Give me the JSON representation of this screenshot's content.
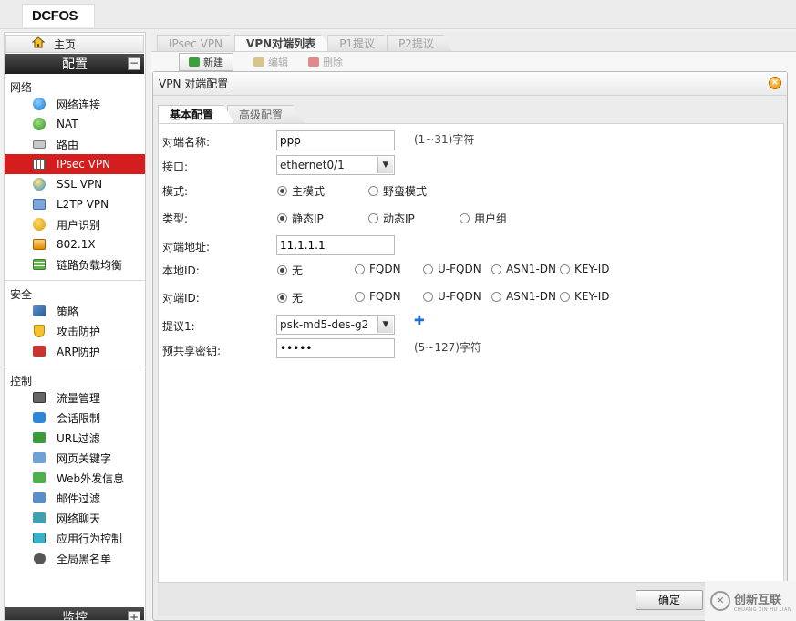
{
  "app": {
    "logo": "DCFOS"
  },
  "sidebar": {
    "home_label": "主页",
    "config_label": "配置",
    "config_toggle": "−",
    "groups": [
      {
        "title": "网络",
        "items": [
          {
            "label": "网络连接",
            "icon": "globe-icon"
          },
          {
            "label": "NAT",
            "icon": "nat-icon"
          },
          {
            "label": "路由",
            "icon": "route-icon"
          },
          {
            "label": "IPsec VPN",
            "icon": "ipsec-icon",
            "active": true
          },
          {
            "label": "SSL VPN",
            "icon": "ssl-vpn-icon"
          },
          {
            "label": "L2TP VPN",
            "icon": "l2tp-icon"
          },
          {
            "label": "用户识别",
            "icon": "user-icon"
          },
          {
            "label": "802.1X",
            "icon": "dot1x-icon"
          },
          {
            "label": "链路负载均衡",
            "icon": "load-balance-icon"
          }
        ]
      },
      {
        "title": "安全",
        "items": [
          {
            "label": "策略",
            "icon": "policy-icon"
          },
          {
            "label": "攻击防护",
            "icon": "shield-icon"
          },
          {
            "label": "ARP防护",
            "icon": "arp-icon"
          }
        ]
      },
      {
        "title": "控制",
        "items": [
          {
            "label": "流量管理",
            "icon": "flow-icon"
          },
          {
            "label": "会话限制",
            "icon": "session-icon"
          },
          {
            "label": "URL过滤",
            "icon": "url-filter-icon"
          },
          {
            "label": "网页关键字",
            "icon": "keyword-icon"
          },
          {
            "label": "Web外发信息",
            "icon": "web-out-icon"
          },
          {
            "label": "邮件过滤",
            "icon": "mail-filter-icon"
          },
          {
            "label": "网络聊天",
            "icon": "chat-icon"
          },
          {
            "label": "应用行为控制",
            "icon": "app-control-icon"
          },
          {
            "label": "全局黑名单",
            "icon": "blacklist-icon"
          }
        ]
      }
    ],
    "monitor_label": "监控",
    "monitor_toggle": "+"
  },
  "main": {
    "tabs": [
      {
        "label": "IPsec VPN",
        "active": false
      },
      {
        "label": "VPN对端列表",
        "active": true
      },
      {
        "label": "P1提议",
        "active": false
      },
      {
        "label": "P2提议",
        "active": false
      }
    ],
    "toolbar": {
      "new_label": "新建",
      "edit_label": "编辑",
      "delete_label": "删除"
    }
  },
  "dialog": {
    "title": "VPN 对端配置",
    "close_icon": "close-icon",
    "tabs": [
      {
        "label": "基本配置",
        "active": true
      },
      {
        "label": "高级配置",
        "active": false
      }
    ],
    "fields": {
      "peer_name": {
        "label": "对端名称:",
        "value": "ppp",
        "hint": "(1~31)字符"
      },
      "interface": {
        "label": "接口:",
        "value": "ethernet0/1"
      },
      "mode": {
        "label": "模式:",
        "options": [
          "主模式",
          "野蛮模式"
        ],
        "selected": 0
      },
      "type": {
        "label": "类型:",
        "options": [
          "静态IP",
          "动态IP",
          "用户组"
        ],
        "selected": 0
      },
      "peer_address": {
        "label": "对端地址:",
        "value": "11.1.1.1"
      },
      "local_id": {
        "label": "本地ID:",
        "options": [
          "无",
          "FQDN",
          "U-FQDN",
          "ASN1-DN",
          "KEY-ID"
        ],
        "selected": 0
      },
      "peer_id": {
        "label": "对端ID:",
        "options": [
          "无",
          "FQDN",
          "U-FQDN",
          "ASN1-DN",
          "KEY-ID"
        ],
        "selected": 0
      },
      "proposal1": {
        "label": "提议1:",
        "value": "psk-md5-des-g2"
      },
      "psk": {
        "label": "预共享密钥:",
        "value": "•••••",
        "hint": "(5~127)字符"
      }
    },
    "ok_label": "确定"
  },
  "watermark": {
    "text": "创新互联",
    "sub": "CHUANG XIN HU LIAN"
  }
}
